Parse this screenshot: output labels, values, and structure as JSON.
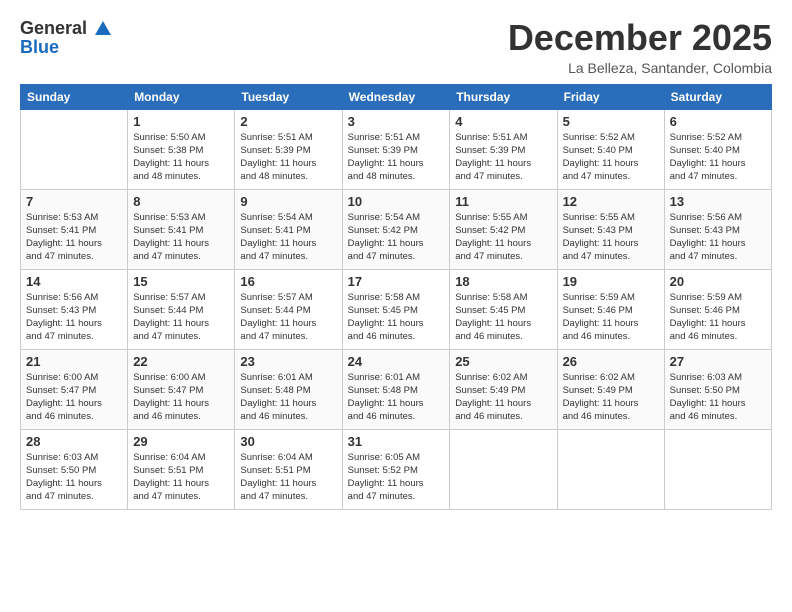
{
  "logo": {
    "general": "General",
    "blue": "Blue",
    "bird_symbol": "▲"
  },
  "title": "December 2025",
  "subtitle": "La Belleza, Santander, Colombia",
  "days_header": [
    "Sunday",
    "Monday",
    "Tuesday",
    "Wednesday",
    "Thursday",
    "Friday",
    "Saturday"
  ],
  "weeks": [
    [
      {
        "day": "",
        "sunrise": "",
        "sunset": "",
        "daylight": ""
      },
      {
        "day": "1",
        "sunrise": "Sunrise: 5:50 AM",
        "sunset": "Sunset: 5:38 PM",
        "daylight": "Daylight: 11 hours and 48 minutes."
      },
      {
        "day": "2",
        "sunrise": "Sunrise: 5:51 AM",
        "sunset": "Sunset: 5:39 PM",
        "daylight": "Daylight: 11 hours and 48 minutes."
      },
      {
        "day": "3",
        "sunrise": "Sunrise: 5:51 AM",
        "sunset": "Sunset: 5:39 PM",
        "daylight": "Daylight: 11 hours and 48 minutes."
      },
      {
        "day": "4",
        "sunrise": "Sunrise: 5:51 AM",
        "sunset": "Sunset: 5:39 PM",
        "daylight": "Daylight: 11 hours and 47 minutes."
      },
      {
        "day": "5",
        "sunrise": "Sunrise: 5:52 AM",
        "sunset": "Sunset: 5:40 PM",
        "daylight": "Daylight: 11 hours and 47 minutes."
      },
      {
        "day": "6",
        "sunrise": "Sunrise: 5:52 AM",
        "sunset": "Sunset: 5:40 PM",
        "daylight": "Daylight: 11 hours and 47 minutes."
      }
    ],
    [
      {
        "day": "7",
        "sunrise": "Sunrise: 5:53 AM",
        "sunset": "Sunset: 5:41 PM",
        "daylight": "Daylight: 11 hours and 47 minutes."
      },
      {
        "day": "8",
        "sunrise": "Sunrise: 5:53 AM",
        "sunset": "Sunset: 5:41 PM",
        "daylight": "Daylight: 11 hours and 47 minutes."
      },
      {
        "day": "9",
        "sunrise": "Sunrise: 5:54 AM",
        "sunset": "Sunset: 5:41 PM",
        "daylight": "Daylight: 11 hours and 47 minutes."
      },
      {
        "day": "10",
        "sunrise": "Sunrise: 5:54 AM",
        "sunset": "Sunset: 5:42 PM",
        "daylight": "Daylight: 11 hours and 47 minutes."
      },
      {
        "day": "11",
        "sunrise": "Sunrise: 5:55 AM",
        "sunset": "Sunset: 5:42 PM",
        "daylight": "Daylight: 11 hours and 47 minutes."
      },
      {
        "day": "12",
        "sunrise": "Sunrise: 5:55 AM",
        "sunset": "Sunset: 5:43 PM",
        "daylight": "Daylight: 11 hours and 47 minutes."
      },
      {
        "day": "13",
        "sunrise": "Sunrise: 5:56 AM",
        "sunset": "Sunset: 5:43 PM",
        "daylight": "Daylight: 11 hours and 47 minutes."
      }
    ],
    [
      {
        "day": "14",
        "sunrise": "Sunrise: 5:56 AM",
        "sunset": "Sunset: 5:43 PM",
        "daylight": "Daylight: 11 hours and 47 minutes."
      },
      {
        "day": "15",
        "sunrise": "Sunrise: 5:57 AM",
        "sunset": "Sunset: 5:44 PM",
        "daylight": "Daylight: 11 hours and 47 minutes."
      },
      {
        "day": "16",
        "sunrise": "Sunrise: 5:57 AM",
        "sunset": "Sunset: 5:44 PM",
        "daylight": "Daylight: 11 hours and 47 minutes."
      },
      {
        "day": "17",
        "sunrise": "Sunrise: 5:58 AM",
        "sunset": "Sunset: 5:45 PM",
        "daylight": "Daylight: 11 hours and 46 minutes."
      },
      {
        "day": "18",
        "sunrise": "Sunrise: 5:58 AM",
        "sunset": "Sunset: 5:45 PM",
        "daylight": "Daylight: 11 hours and 46 minutes."
      },
      {
        "day": "19",
        "sunrise": "Sunrise: 5:59 AM",
        "sunset": "Sunset: 5:46 PM",
        "daylight": "Daylight: 11 hours and 46 minutes."
      },
      {
        "day": "20",
        "sunrise": "Sunrise: 5:59 AM",
        "sunset": "Sunset: 5:46 PM",
        "daylight": "Daylight: 11 hours and 46 minutes."
      }
    ],
    [
      {
        "day": "21",
        "sunrise": "Sunrise: 6:00 AM",
        "sunset": "Sunset: 5:47 PM",
        "daylight": "Daylight: 11 hours and 46 minutes."
      },
      {
        "day": "22",
        "sunrise": "Sunrise: 6:00 AM",
        "sunset": "Sunset: 5:47 PM",
        "daylight": "Daylight: 11 hours and 46 minutes."
      },
      {
        "day": "23",
        "sunrise": "Sunrise: 6:01 AM",
        "sunset": "Sunset: 5:48 PM",
        "daylight": "Daylight: 11 hours and 46 minutes."
      },
      {
        "day": "24",
        "sunrise": "Sunrise: 6:01 AM",
        "sunset": "Sunset: 5:48 PM",
        "daylight": "Daylight: 11 hours and 46 minutes."
      },
      {
        "day": "25",
        "sunrise": "Sunrise: 6:02 AM",
        "sunset": "Sunset: 5:49 PM",
        "daylight": "Daylight: 11 hours and 46 minutes."
      },
      {
        "day": "26",
        "sunrise": "Sunrise: 6:02 AM",
        "sunset": "Sunset: 5:49 PM",
        "daylight": "Daylight: 11 hours and 46 minutes."
      },
      {
        "day": "27",
        "sunrise": "Sunrise: 6:03 AM",
        "sunset": "Sunset: 5:50 PM",
        "daylight": "Daylight: 11 hours and 46 minutes."
      }
    ],
    [
      {
        "day": "28",
        "sunrise": "Sunrise: 6:03 AM",
        "sunset": "Sunset: 5:50 PM",
        "daylight": "Daylight: 11 hours and 47 minutes."
      },
      {
        "day": "29",
        "sunrise": "Sunrise: 6:04 AM",
        "sunset": "Sunset: 5:51 PM",
        "daylight": "Daylight: 11 hours and 47 minutes."
      },
      {
        "day": "30",
        "sunrise": "Sunrise: 6:04 AM",
        "sunset": "Sunset: 5:51 PM",
        "daylight": "Daylight: 11 hours and 47 minutes."
      },
      {
        "day": "31",
        "sunrise": "Sunrise: 6:05 AM",
        "sunset": "Sunset: 5:52 PM",
        "daylight": "Daylight: 11 hours and 47 minutes."
      },
      {
        "day": "",
        "sunrise": "",
        "sunset": "",
        "daylight": ""
      },
      {
        "day": "",
        "sunrise": "",
        "sunset": "",
        "daylight": ""
      },
      {
        "day": "",
        "sunrise": "",
        "sunset": "",
        "daylight": ""
      }
    ]
  ]
}
